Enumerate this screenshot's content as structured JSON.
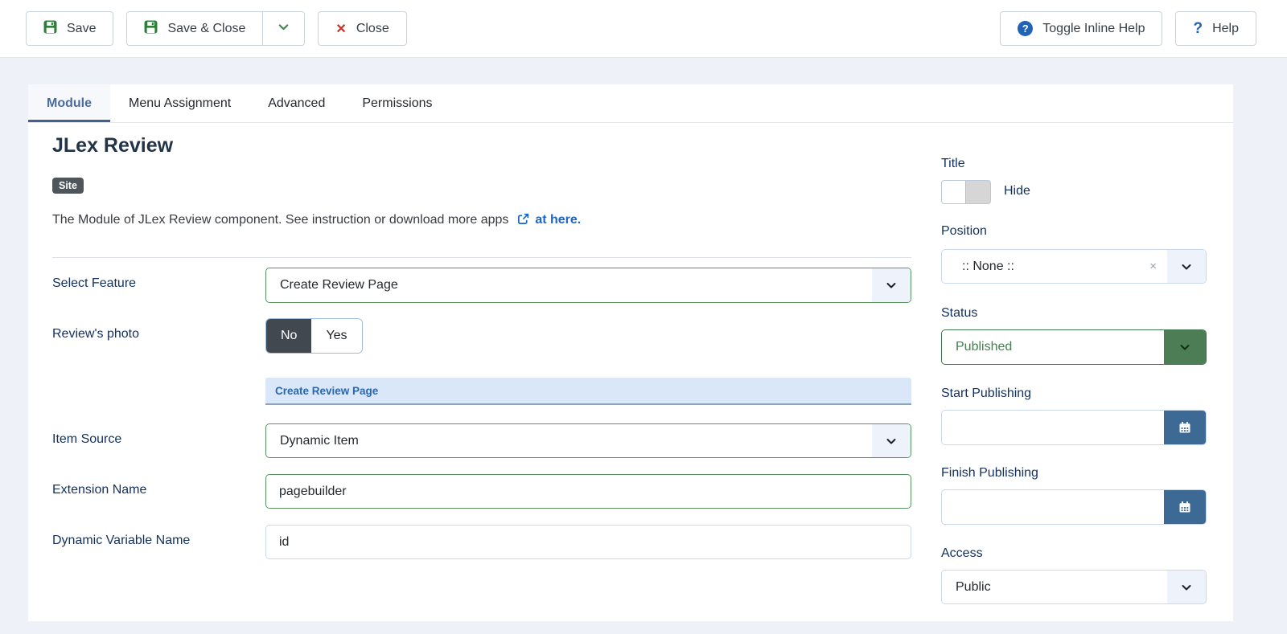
{
  "toolbar": {
    "save": "Save",
    "save_close": "Save & Close",
    "close": "Close",
    "toggle_inline_help": "Toggle Inline Help",
    "help": "Help"
  },
  "icons": {
    "question_glyph": "?",
    "close_x_glyph": "✕",
    "clear_x_glyph": "×"
  },
  "tabs": [
    {
      "label": "Module",
      "active": true
    },
    {
      "label": "Menu Assignment",
      "active": false
    },
    {
      "label": "Advanced",
      "active": false
    },
    {
      "label": "Permissions",
      "active": false
    }
  ],
  "module": {
    "title": "JLex Review",
    "badge": "Site",
    "description": "The Module of JLex Review component. See instruction or download more apps",
    "description_link": "at here."
  },
  "form": {
    "select_feature": {
      "label": "Select Feature",
      "value": "Create Review Page"
    },
    "reviews_photo": {
      "label": "Review's photo",
      "options": [
        "No",
        "Yes"
      ],
      "selected": "No"
    },
    "section_header": "Create Review Page",
    "item_source": {
      "label": "Item Source",
      "value": "Dynamic Item"
    },
    "extension_name": {
      "label": "Extension Name",
      "value": "pagebuilder"
    },
    "dynamic_variable_name": {
      "label": "Dynamic Variable Name",
      "value": "id"
    }
  },
  "sidebar": {
    "title": {
      "label": "Title",
      "toggle_label": "Hide"
    },
    "position": {
      "label": "Position",
      "value": ":: None ::"
    },
    "status": {
      "label": "Status",
      "value": "Published"
    },
    "start_publishing": {
      "label": "Start Publishing",
      "value": ""
    },
    "finish_publishing": {
      "label": "Finish Publishing",
      "value": ""
    },
    "access": {
      "label": "Access",
      "value": "Public"
    }
  },
  "colors": {
    "page_background": "#eef1f7",
    "accent_blue": "#2163b4",
    "link_blue": "#1b66c9",
    "success_green": "#2f7d3b",
    "status_green": "#4c7d55",
    "danger_red": "#c5342b",
    "label_navy": "#12305e",
    "calendar_button_blue": "#3d6a95",
    "section_header_bg": "#d9e7f8",
    "active_tab_underline": "#42618e"
  }
}
